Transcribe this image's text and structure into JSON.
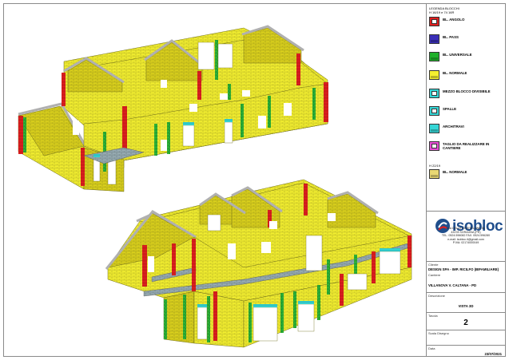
{
  "legend": {
    "title_lines": [
      "LEGENDA BLOCCHI",
      "H 16/19 e 74 16R"
    ],
    "items": [
      {
        "label": "BL. ANGOLO",
        "color": "#e02020",
        "icon": "corner-block-icon"
      },
      {
        "label": "BL. PASS",
        "color": "#3a2fb8",
        "icon": "pass-block-icon"
      },
      {
        "label": "BL. UNIVERSALE",
        "color": "#1fb02a",
        "icon": "universal-block-icon"
      },
      {
        "label": "BL. NORMALE",
        "color": "#f4f030",
        "icon": "normal-block-icon"
      },
      {
        "label": "MEZZO BLOCCO DIVISIBILE",
        "color": "#36d6d6",
        "icon": "half-block-icon"
      },
      {
        "label": "SPALLE",
        "color": "#36d6d6",
        "icon": "shoulder-block-icon"
      },
      {
        "label": "ARCHITRAVI",
        "color": "#36d6d6",
        "icon": "lintel-block-icon"
      },
      {
        "label": "TAGLIO DA REALIZZARE IN CANTIERE",
        "color": "#e84fd6",
        "icon": "cut-block-icon"
      }
    ],
    "sub_title": "H 22/19",
    "sub_item": {
      "label": "BL. NORMALE",
      "color": "#e9d873",
      "icon": "normal-block-h22-icon"
    }
  },
  "company": {
    "name": "isobloc",
    "contact_lines": [
      "VIA DELLE CRISTELLINE 36",
      "43378 SORAGNA (PR)",
      "TEL. 0524.596082 FAX. 0524.596280",
      "e-mail: isobloc.it@gmail.com",
      "P.IVA: 02174000049"
    ]
  },
  "title_block": {
    "cliente_label": "Cliente",
    "cliente_value": "DESIGN SPA - IMP. RICILFO (BIFAMILIARE)",
    "cantiere_label": "Cantiere",
    "cantiere_value": "VILLANOVA V. CALTANA - PD",
    "descrizione_label": "Descrizione",
    "descrizione_value": "VISTA 3D",
    "tavola_label": "Tavola",
    "tavola_value": "2",
    "scala_label": "Scala Disegno",
    "scala_value": "",
    "data_label": "Data",
    "data_value": "23/07/2021"
  },
  "colors": {
    "normal": "#f4f030",
    "wall_side": "#dcd21c",
    "corner": "#e02020",
    "universal": "#1fb02a",
    "half": "#36d6d6",
    "h22": "#e9d873",
    "slab": "#bcbcbc",
    "grey_blocks": "#8aa0a8"
  }
}
